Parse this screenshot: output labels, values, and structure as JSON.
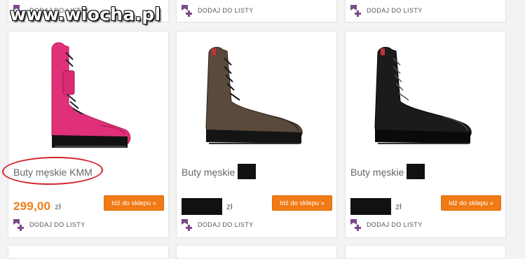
{
  "watermark": "www.wiocha.pl",
  "add_to_list_label": "DODAJ DO LISTY",
  "products": [
    {
      "name": "Buty męskie KMM",
      "price": "299,00",
      "currency": "zł",
      "shop_button": "Idź do sklepu »",
      "boot_color": "#e0307a",
      "circled": true,
      "redacted": false
    },
    {
      "name": "Buty męskie",
      "price": "",
      "currency": "zł",
      "shop_button": "Idź do sklepu »",
      "boot_color": "#5a4a3c",
      "circled": false,
      "redacted": true
    },
    {
      "name": "Buty męskie",
      "price": "",
      "currency": "zł",
      "shop_button": "Idź do sklepu »",
      "boot_color": "#1b1b1b",
      "circled": false,
      "redacted": true
    }
  ],
  "colors": {
    "accent": "#f07a16",
    "price": "#f07d19",
    "icon": "#7b4a8a",
    "annotation": "#d2232a"
  },
  "icons": {
    "add_to_list": "add-to-list-icon",
    "product_image": "boot-photo"
  }
}
